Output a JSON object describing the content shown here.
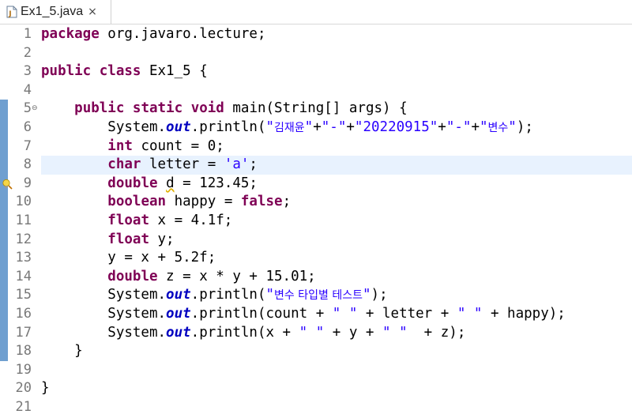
{
  "tab": {
    "title": "Ex1_5.java",
    "close": "×",
    "icon": "java-file-icon"
  },
  "editor": {
    "line_numbers": [
      "1",
      "2",
      "3",
      "4",
      "5",
      "6",
      "7",
      "8",
      "9",
      "10",
      "11",
      "12",
      "13",
      "14",
      "15",
      "16",
      "17",
      "18",
      "19",
      "20",
      "21"
    ],
    "current_line": 8,
    "lines": [
      [
        {
          "t": "kw",
          "v": "package"
        },
        {
          "t": "p",
          "v": " org.javaro.lecture;"
        }
      ],
      [],
      [
        {
          "t": "kw",
          "v": "public"
        },
        {
          "t": "p",
          "v": " "
        },
        {
          "t": "kw",
          "v": "class"
        },
        {
          "t": "p",
          "v": " Ex1_5 {"
        }
      ],
      [],
      [
        {
          "t": "p",
          "v": "    "
        },
        {
          "t": "kw",
          "v": "public"
        },
        {
          "t": "p",
          "v": " "
        },
        {
          "t": "kw",
          "v": "static"
        },
        {
          "t": "p",
          "v": " "
        },
        {
          "t": "kw",
          "v": "void"
        },
        {
          "t": "p",
          "v": " main(String[] args) {"
        }
      ],
      [
        {
          "t": "p",
          "v": "        System."
        },
        {
          "t": "fld",
          "v": "out"
        },
        {
          "t": "p",
          "v": ".println("
        },
        {
          "t": "str",
          "v": "\""
        },
        {
          "t": "strko",
          "v": "김재윤"
        },
        {
          "t": "str",
          "v": "\""
        },
        {
          "t": "p",
          "v": "+"
        },
        {
          "t": "str",
          "v": "\"-\""
        },
        {
          "t": "p",
          "v": "+"
        },
        {
          "t": "str",
          "v": "\"20220915\""
        },
        {
          "t": "p",
          "v": "+"
        },
        {
          "t": "str",
          "v": "\"-\""
        },
        {
          "t": "p",
          "v": "+"
        },
        {
          "t": "str",
          "v": "\""
        },
        {
          "t": "strko",
          "v": "변수"
        },
        {
          "t": "str",
          "v": "\""
        },
        {
          "t": "p",
          "v": ");"
        }
      ],
      [
        {
          "t": "p",
          "v": "        "
        },
        {
          "t": "kw",
          "v": "int"
        },
        {
          "t": "p",
          "v": " count = 0;"
        }
      ],
      [
        {
          "t": "p",
          "v": "        "
        },
        {
          "t": "kw",
          "v": "char"
        },
        {
          "t": "p",
          "v": " letter = "
        },
        {
          "t": "str",
          "v": "'a'"
        },
        {
          "t": "p",
          "v": ";"
        }
      ],
      [
        {
          "t": "p",
          "v": "        "
        },
        {
          "t": "kw",
          "v": "double"
        },
        {
          "t": "p",
          "v": " "
        },
        {
          "t": "warn",
          "v": "d"
        },
        {
          "t": "p",
          "v": " = 123.45;"
        }
      ],
      [
        {
          "t": "p",
          "v": "        "
        },
        {
          "t": "kw",
          "v": "boolean"
        },
        {
          "t": "p",
          "v": " happy = "
        },
        {
          "t": "kw",
          "v": "false"
        },
        {
          "t": "p",
          "v": ";"
        }
      ],
      [
        {
          "t": "p",
          "v": "        "
        },
        {
          "t": "kw",
          "v": "float"
        },
        {
          "t": "p",
          "v": " x = 4.1f;"
        }
      ],
      [
        {
          "t": "p",
          "v": "        "
        },
        {
          "t": "kw",
          "v": "float"
        },
        {
          "t": "p",
          "v": " y;"
        }
      ],
      [
        {
          "t": "p",
          "v": "        y = x + 5.2f;"
        }
      ],
      [
        {
          "t": "p",
          "v": "        "
        },
        {
          "t": "kw",
          "v": "double"
        },
        {
          "t": "p",
          "v": " z = x * y + 15.01;"
        }
      ],
      [
        {
          "t": "p",
          "v": "        System."
        },
        {
          "t": "fld",
          "v": "out"
        },
        {
          "t": "p",
          "v": ".println("
        },
        {
          "t": "str",
          "v": "\""
        },
        {
          "t": "strko",
          "v": "변수 타입별 테스트"
        },
        {
          "t": "str",
          "v": "\""
        },
        {
          "t": "p",
          "v": ");"
        }
      ],
      [
        {
          "t": "p",
          "v": "        System."
        },
        {
          "t": "fld",
          "v": "out"
        },
        {
          "t": "p",
          "v": ".println(count + "
        },
        {
          "t": "str",
          "v": "\" \""
        },
        {
          "t": "p",
          "v": " + letter + "
        },
        {
          "t": "str",
          "v": "\" \""
        },
        {
          "t": "p",
          "v": " + happy);"
        }
      ],
      [
        {
          "t": "p",
          "v": "        System."
        },
        {
          "t": "fld",
          "v": "out"
        },
        {
          "t": "p",
          "v": ".println(x + "
        },
        {
          "t": "str",
          "v": "\" \""
        },
        {
          "t": "p",
          "v": " + y + "
        },
        {
          "t": "str",
          "v": "\" \""
        },
        {
          "t": "p",
          "v": "  + z);"
        }
      ],
      [
        {
          "t": "p",
          "v": "    }"
        }
      ],
      [],
      [
        {
          "t": "p",
          "v": "}"
        }
      ],
      []
    ],
    "fold_markers": {
      "5": "⊖"
    },
    "warning_line": 9,
    "warning_icon": "lightbulb-warning-icon",
    "changed_range": [
      5,
      18
    ],
    "colors": {
      "keyword": "#7f0055",
      "string": "#2a00ff",
      "field": "#0000c0",
      "line_number": "#787878",
      "current_line_bg": "#e8f2fe",
      "change_bar": "#6f9fd0"
    }
  }
}
